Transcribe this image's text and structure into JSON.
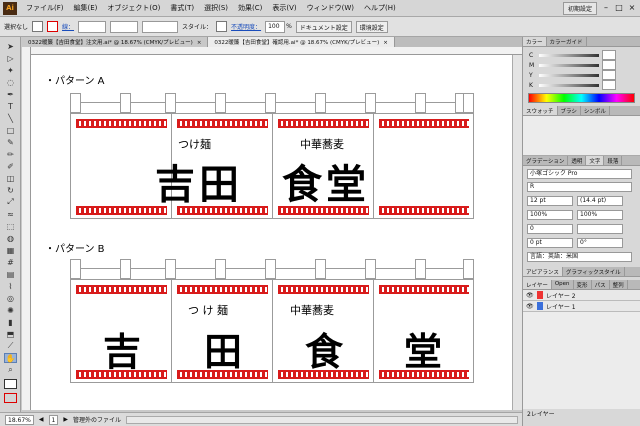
{
  "app": {
    "logo": "Ai"
  },
  "menu": [
    "ファイル(F)",
    "編集(E)",
    "オブジェクト(O)",
    "書式(T)",
    "選択(S)",
    "効果(C)",
    "表示(V)",
    "ウィンドウ(W)",
    "ヘルプ(H)"
  ],
  "workspace": "初期設定",
  "control": {
    "selection": "選択なし",
    "stroke_label": "線：",
    "style_label": "スタイル：",
    "opacity_label": "不透明度：",
    "opacity_value": "100",
    "opacity_unit": "%",
    "doc_setup": "ドキュメント設定",
    "env_setup": "環境設定"
  },
  "tabs": [
    {
      "label": "0322暖簾【吉田食堂】注文用.ai* @ 18.67% (CMYK/プレビュー)",
      "close": "×"
    },
    {
      "label": "0322暖簾【吉田食堂】確認用.ai* @ 18.67% (CMYK/プレビュー)",
      "close": "×"
    }
  ],
  "artboard": {
    "pattern_a": {
      "title": "・パターン A",
      "sub1": "つけ麺",
      "sub2": "中華蕎麦",
      "main": [
        "吉田",
        "食堂"
      ]
    },
    "pattern_b": {
      "title": "・パターン B",
      "sub1": "つ け 麺",
      "sub2": "中華蕎麦",
      "main": [
        "吉",
        "田",
        "食",
        "堂"
      ]
    }
  },
  "status": {
    "zoom": "18.67%",
    "page": "1",
    "info": "管理外のファイル"
  },
  "panels": {
    "color_tabs": [
      "カラー",
      "カラーガイド"
    ],
    "color_rows": [
      "C",
      "M",
      "Y",
      "K"
    ],
    "swatch_tabs": [
      "スウォッチ",
      "ブラシ",
      "シンボル"
    ],
    "char_tabs": [
      "グラデーション",
      "透明",
      "文字",
      "段落"
    ],
    "font": "小塚ゴシック Pro",
    "font_style": "R",
    "size": "12 pt",
    "leading": "(14.4 pt)",
    "scale_v": "100%",
    "scale_h": "100%",
    "tracking": "0",
    "baseline": "0 pt",
    "rotation": "0°",
    "language": "言語：英語：米国",
    "appearance_tabs": [
      "アピアランス",
      "グラフィックスタイル"
    ],
    "layer_tabs": [
      "レイヤー",
      "Open",
      "変形",
      "パス",
      "整列"
    ],
    "layers": [
      "レイヤー 2",
      "レイヤー 1"
    ],
    "layer_count": "2レイヤー"
  },
  "colors": {
    "accent_red": "#d81b1b",
    "canvas": "#ffffff",
    "ui_gray": "#d6d6d6"
  }
}
